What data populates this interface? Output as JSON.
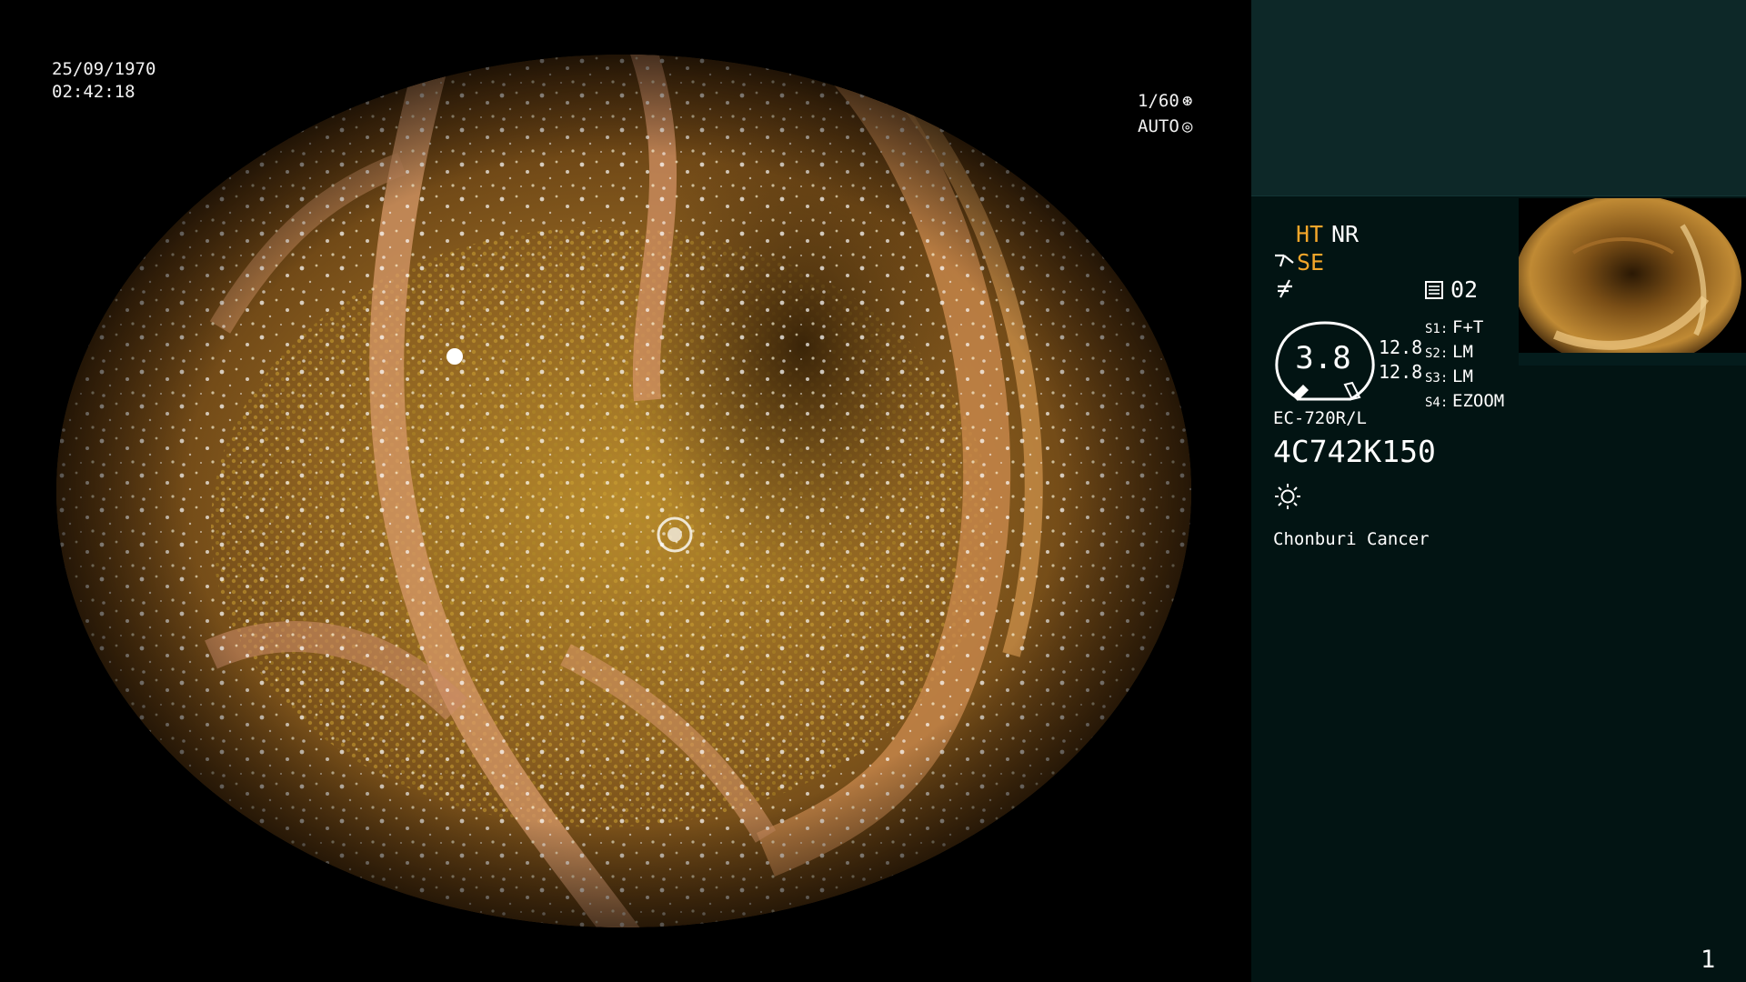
{
  "overlay": {
    "date": "25/09/1970",
    "time": "02:42:18",
    "shutter": "1/60",
    "exposure": "AUTO",
    "shutter_icon": "aperture-icon",
    "exposure_icon": "auto-iris-icon"
  },
  "panel": {
    "ht_label": "HT",
    "nr_label": "NR",
    "se_label": "SE",
    "memo_number": "02",
    "dial_value": "3.8",
    "value_a": "12.8",
    "value_b": "12.8",
    "switches": [
      {
        "key": "S1:",
        "value": "F+T"
      },
      {
        "key": "S2:",
        "value": "LM"
      },
      {
        "key": "S3:",
        "value": "LM"
      },
      {
        "key": "S4:",
        "value": "EZOOM"
      }
    ],
    "scope_model": "EC-720R/L",
    "serial": "4C742K150",
    "hospital": "Chonburi Cancer",
    "page_number": "1"
  },
  "colors": {
    "panel_bg": "#021413",
    "top_band": "#0d2828",
    "accent_orange": "#f4a62a",
    "tissue": "#8a5a1c"
  }
}
